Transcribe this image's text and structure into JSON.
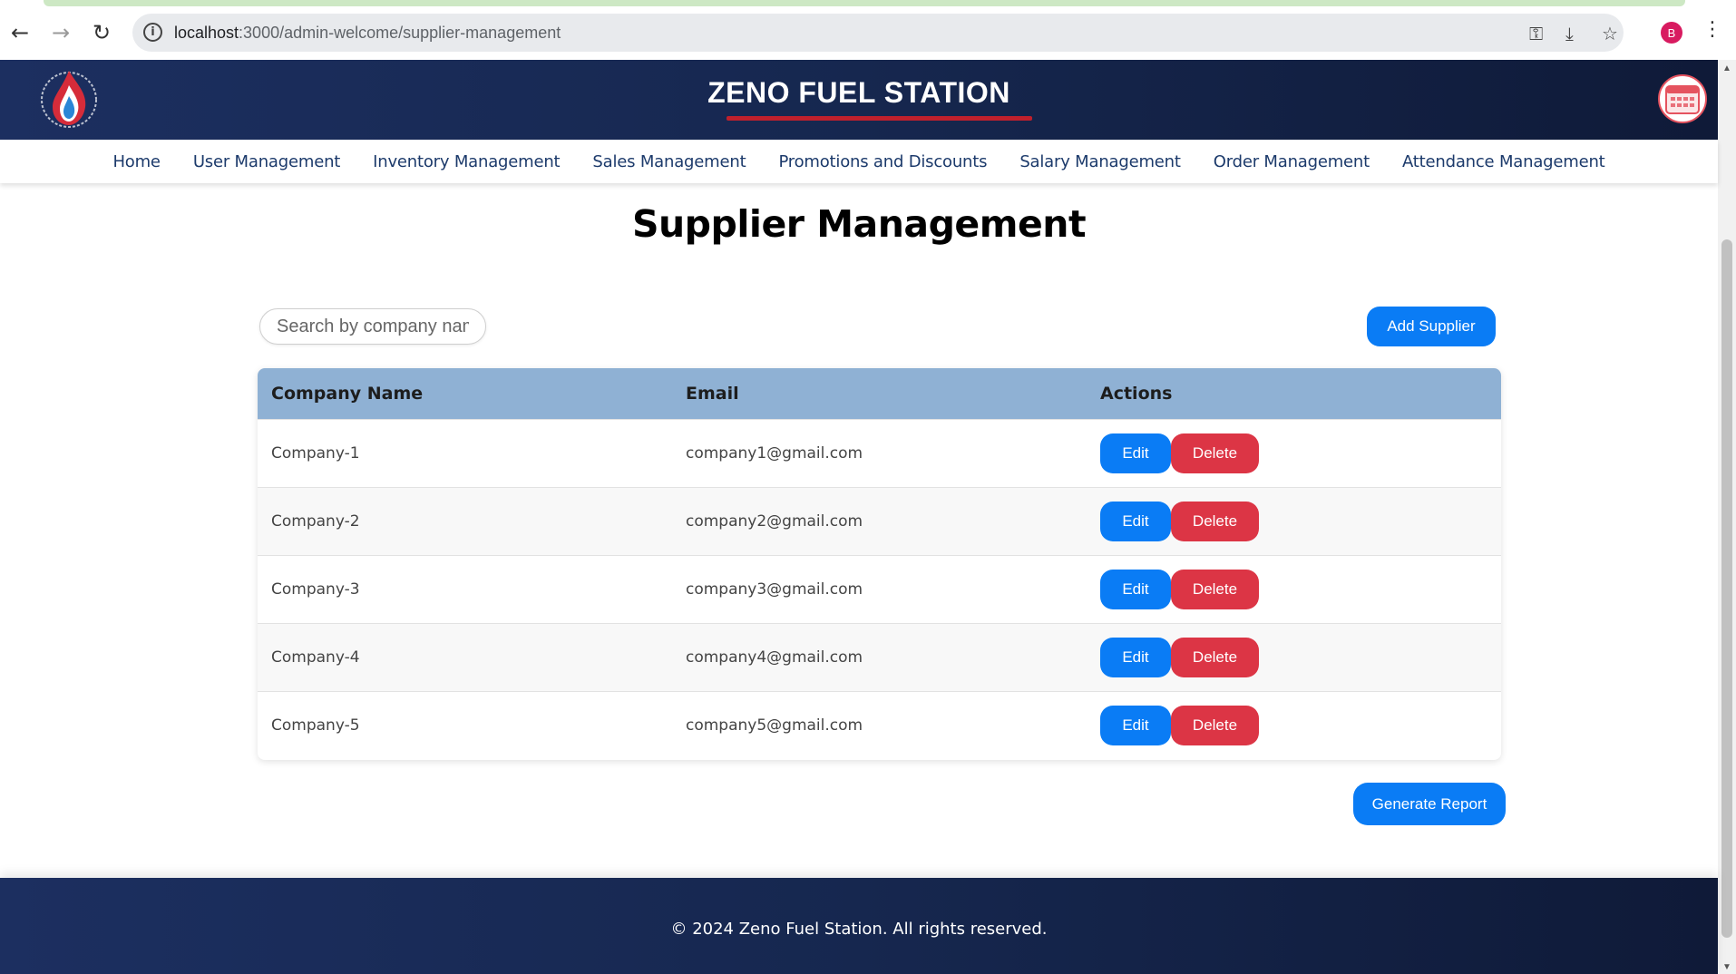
{
  "browser": {
    "url_host": "localhost",
    "url_path": ":3000/admin-welcome/supplier-management",
    "profile_initial": "B"
  },
  "header": {
    "brand_title": "ZENO FUEL STATION"
  },
  "nav": {
    "items": [
      {
        "label": "Home"
      },
      {
        "label": "User Management"
      },
      {
        "label": "Inventory Management"
      },
      {
        "label": "Sales Management"
      },
      {
        "label": "Promotions and Discounts"
      },
      {
        "label": "Salary Management"
      },
      {
        "label": "Order Management"
      },
      {
        "label": "Attendance Management"
      }
    ]
  },
  "page": {
    "title": "Supplier Management",
    "search_placeholder": "Search by company name",
    "add_button": "Add Supplier",
    "report_button": "Generate Report"
  },
  "table": {
    "headers": [
      "Company Name",
      "Email",
      "Actions"
    ],
    "edit_label": "Edit",
    "delete_label": "Delete",
    "rows": [
      {
        "company": "Company-1",
        "email": "company1@gmail.com"
      },
      {
        "company": "Company-2",
        "email": "company2@gmail.com"
      },
      {
        "company": "Company-3",
        "email": "company3@gmail.com"
      },
      {
        "company": "Company-4",
        "email": "company4@gmail.com"
      },
      {
        "company": "Company-5",
        "email": "company5@gmail.com"
      }
    ]
  },
  "footer": {
    "text": "© 2024 Zeno Fuel Station. All rights reserved."
  },
  "colors": {
    "primary_button": "#0a7cf5",
    "danger_button": "#dc3545",
    "header_bg": "#16274f",
    "table_header_bg": "#8fb1d4"
  }
}
